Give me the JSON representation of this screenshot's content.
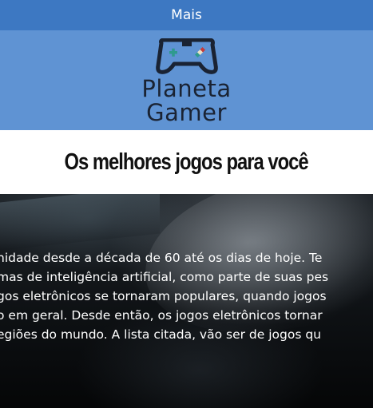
{
  "topbar": {
    "menu_label": "Mais"
  },
  "logo": {
    "line1": "Planeta",
    "line2": "Gamer",
    "icon": "gamepad-icon"
  },
  "title": "Os melhores jogos para você",
  "hero": {
    "lines": [
      "nidade desde a década de 60 até os dias de hoje. Te",
      "mas de inteligência artificial, como parte de suas pes",
      "gos eletrônicos se tornaram populares, quando jogos",
      "o em geral. Desde então, os jogos eletrônicos tornar",
      "egiões do mundo. A lista citada, vão ser de jogos qu"
    ]
  },
  "colors": {
    "topbar": "#3d78c2",
    "header": "#5f93d3",
    "logo_text": "#1a2333"
  }
}
